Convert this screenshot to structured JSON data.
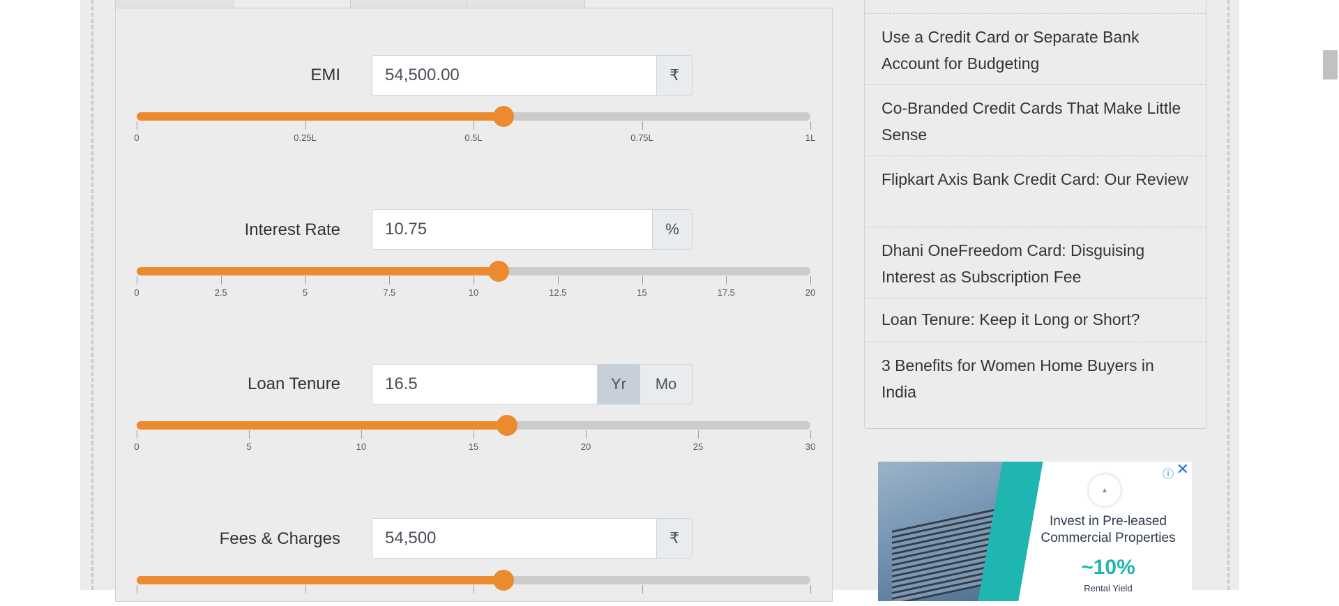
{
  "calculator": {
    "emi": {
      "label": "EMI",
      "value": "54,500.00",
      "unit": "₹",
      "slider_fraction": 0.545,
      "scale": [
        "0",
        "0.25L",
        "0.5L",
        "0.75L",
        "1L"
      ]
    },
    "interest_rate": {
      "label": "Interest Rate",
      "value": "10.75",
      "unit": "%",
      "slider_fraction": 0.5375,
      "scale": [
        "0",
        "2.5",
        "5",
        "7.5",
        "10",
        "12.5",
        "15",
        "17.5",
        "20"
      ]
    },
    "loan_tenure": {
      "label": "Loan Tenure",
      "value": "16.5",
      "unit_year": "Yr",
      "unit_month": "Mo",
      "selected_unit": "Yr",
      "slider_fraction": 0.55,
      "scale": [
        "0",
        "5",
        "10",
        "15",
        "20",
        "25",
        "30"
      ]
    },
    "fees_charges": {
      "label": "Fees & Charges",
      "value": "54,500",
      "unit": "₹",
      "slider_fraction": 0.545
    }
  },
  "related_articles": [
    "Use a Credit Card or Separate Bank Account for Budgeting",
    "Co-Branded Credit Cards That Make Little Sense",
    "Flipkart Axis Bank Credit Card: Our Review",
    "Dhani OneFreedom Card: Disguising Interest as Subscription Fee",
    "Loan Tenure: Keep it Long or Short?",
    "3 Benefits for Women Home Buyers in India"
  ],
  "ad": {
    "title": "Invest in Pre-leased Commercial Properties",
    "yield_value": "~10%",
    "yield_label": "Rental Yield",
    "info_icon": "info-icon",
    "close_icon": "close-icon"
  },
  "colors": {
    "accent": "#ec8a2f",
    "track": "#cccccc",
    "ad_teal": "#1fb5b0"
  }
}
